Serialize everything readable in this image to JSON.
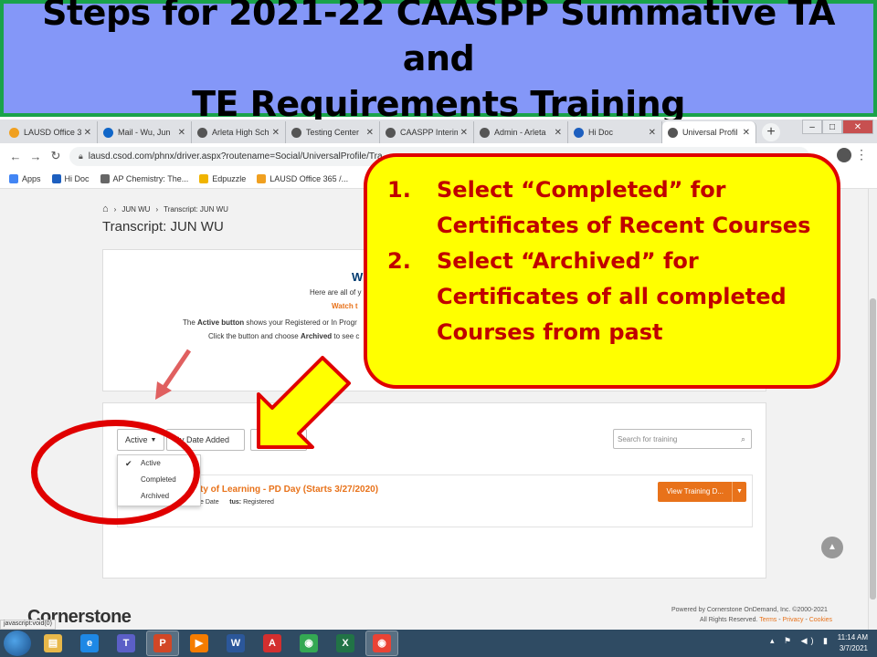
{
  "slide": {
    "title_line1": "Steps for 2021-22 CAASPP Summative TA and",
    "title_line2": "TE Requirements Training"
  },
  "browser": {
    "tabs": [
      {
        "label": "LAUSD Office 3",
        "color": "#f0a020",
        "active": false
      },
      {
        "label": "Mail - Wu, Jun",
        "color": "#1066c8",
        "active": false
      },
      {
        "label": "Arleta High Sch",
        "color": "#555555",
        "active": false
      },
      {
        "label": "Testing Center",
        "color": "#555555",
        "active": false
      },
      {
        "label": "CAASPP Interim",
        "color": "#555555",
        "active": false
      },
      {
        "label": "Admin - Arleta",
        "color": "#555555",
        "active": false
      },
      {
        "label": "Hi Doc",
        "color": "#1d5fbf",
        "active": false
      },
      {
        "label": "Universal Profil",
        "color": "#555555",
        "active": true
      }
    ],
    "new_tab": "+",
    "window_controls": {
      "minimize": "–",
      "maximize": "□",
      "close": "✕"
    },
    "url": "lausd.csod.com/phnx/driver.aspx?routename=Social/UniversalProfile/Tra",
    "bookmarks": [
      {
        "label": "Apps",
        "color": "#4285f4"
      },
      {
        "label": "Hi Doc",
        "color": "#1d5fbf"
      },
      {
        "label": "AP Chemistry: The...",
        "color": "#666666"
      },
      {
        "label": "Edpuzzle",
        "color": "#f0b400"
      },
      {
        "label": "LAUSD Office 365 /...",
        "color": "#f0a020"
      }
    ]
  },
  "page": {
    "breadcrumb": {
      "item1": "JUN WU",
      "item2": "Transcript: JUN WU"
    },
    "title": "Transcript: JUN WU",
    "welcome": {
      "heading": "W",
      "line1": "Here are all of y",
      "line2": "Watch t",
      "line3_pre": "The ",
      "line3_bold": "Active button",
      "line3_post": " shows your Registered or In Progr",
      "line4_pre": "Click the button and choose ",
      "line4_bold": "Archived",
      "line4_post": " to see c"
    },
    "filters": {
      "status_button": "Active",
      "date_button": "By Date Added",
      "third_button": "A",
      "search_placeholder": "Search for training"
    },
    "status_menu": {
      "items": [
        "Active",
        "Completed",
        "Archived"
      ],
      "selected": "Active"
    },
    "training": {
      "title": "ty of Learning - PD Day (Starts 3/27/2020)",
      "meta_date": "e Date",
      "meta_status_label": "tus:",
      "meta_status_value": "Registered",
      "view_button": "View Training D..."
    },
    "logo": "Cornerstone",
    "footer_line1": "Powered by Cornerstone OnDemand, Inc. ©2000-2021",
    "footer_rights": "All Rights Reserved.",
    "footer_terms": "Terms",
    "footer_privacy": "Privacy",
    "footer_cookies": "Cookies",
    "status_url": "javascript:void(0)"
  },
  "callout": {
    "items": [
      {
        "num": "1.",
        "text": "Select “Completed” for Certificates of Recent Courses"
      },
      {
        "num": "2.",
        "text": "Select “Archived” for Certificates of all completed Courses from past"
      }
    ]
  },
  "taskbar": {
    "apps": [
      {
        "name": "file-explorer",
        "glyph": "▤",
        "color": "#e8b84a",
        "active": false
      },
      {
        "name": "internet-explorer",
        "glyph": "e",
        "color": "#1e88e5",
        "active": false
      },
      {
        "name": "teams",
        "glyph": "T",
        "color": "#5b5fc7",
        "active": false
      },
      {
        "name": "powerpoint",
        "glyph": "P",
        "color": "#d24726",
        "active": true
      },
      {
        "name": "media-player",
        "glyph": "▶",
        "color": "#f57c00",
        "active": false
      },
      {
        "name": "word",
        "glyph": "W",
        "color": "#2b579a",
        "active": false
      },
      {
        "name": "acrobat",
        "glyph": "A",
        "color": "#d32f2f",
        "active": false
      },
      {
        "name": "chrome",
        "glyph": "◉",
        "color": "#34a853",
        "active": false
      },
      {
        "name": "excel",
        "glyph": "X",
        "color": "#217346",
        "active": false
      },
      {
        "name": "chrome-active",
        "glyph": "◉",
        "color": "#ea4335",
        "active": true
      }
    ],
    "time": "11:14 AM",
    "date": "3/7/2021"
  },
  "colors": {
    "banner_bg": "#8497f8",
    "banner_border": "#1aa34a",
    "callout_bg": "#ffff00",
    "callout_text": "#c00000",
    "annotation_red": "#e00000",
    "accent_orange": "#e8721a"
  }
}
